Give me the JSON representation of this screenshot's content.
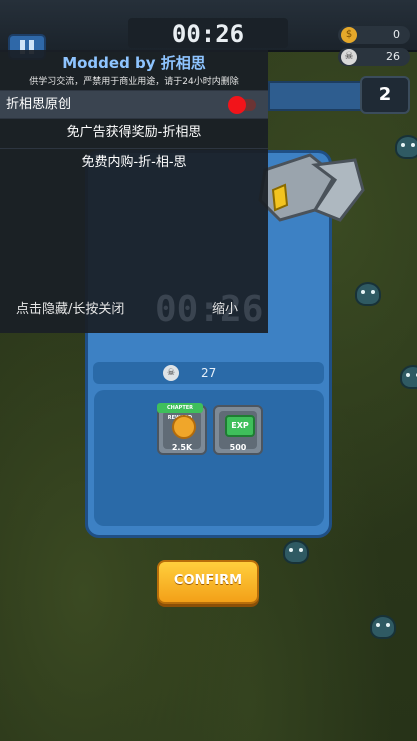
{
  "hud": {
    "timer": "00:26",
    "coins": "0",
    "kills": "26",
    "level": "2"
  },
  "reward_card": {
    "kill_count": "27",
    "rewards": [
      {
        "chip": "CHAPTER REWARD",
        "icon": "coin-icon",
        "amount": "2.5K"
      },
      {
        "chip": "",
        "icon": "exp-icon",
        "label": "EXP",
        "amount": "500"
      }
    ],
    "confirm_label": "CONFIRM"
  },
  "mod_menu": {
    "title": "Modded by 折相思",
    "subtitle": "供学习交流，严禁用于商业用途，请于24小时内删除",
    "toggle_label": "折相思原创",
    "option_1": "免广告获得奖励-折相思",
    "option_2": "免费内购-折-相-思",
    "hide_label": "点击隐藏/长按关闭",
    "ghost_timer": "00:26",
    "minimize_label": "缩小"
  }
}
